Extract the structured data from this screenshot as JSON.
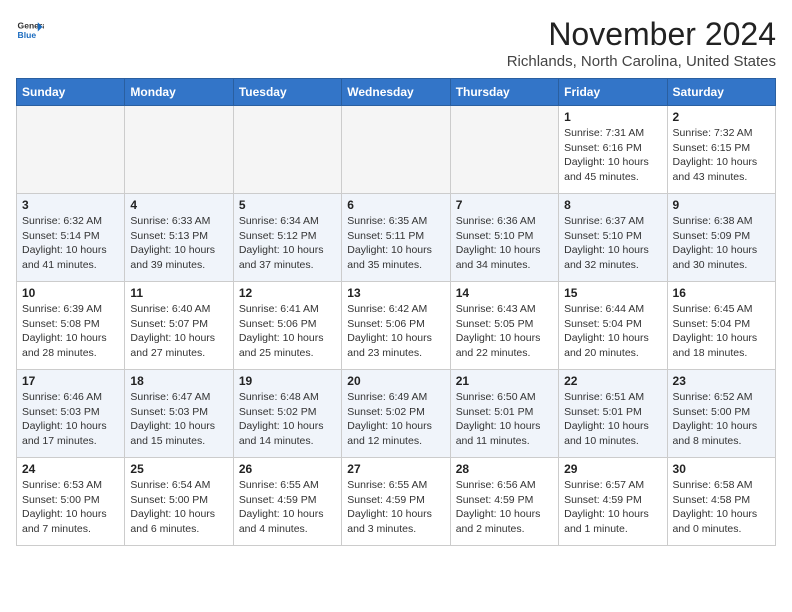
{
  "header": {
    "logo_line1": "General",
    "logo_line2": "Blue",
    "month": "November 2024",
    "location": "Richlands, North Carolina, United States"
  },
  "weekdays": [
    "Sunday",
    "Monday",
    "Tuesday",
    "Wednesday",
    "Thursday",
    "Friday",
    "Saturday"
  ],
  "weeks": [
    [
      {
        "day": "",
        "info": ""
      },
      {
        "day": "",
        "info": ""
      },
      {
        "day": "",
        "info": ""
      },
      {
        "day": "",
        "info": ""
      },
      {
        "day": "",
        "info": ""
      },
      {
        "day": "1",
        "info": "Sunrise: 7:31 AM\nSunset: 6:16 PM\nDaylight: 10 hours and 45 minutes."
      },
      {
        "day": "2",
        "info": "Sunrise: 7:32 AM\nSunset: 6:15 PM\nDaylight: 10 hours and 43 minutes."
      }
    ],
    [
      {
        "day": "3",
        "info": "Sunrise: 6:32 AM\nSunset: 5:14 PM\nDaylight: 10 hours and 41 minutes."
      },
      {
        "day": "4",
        "info": "Sunrise: 6:33 AM\nSunset: 5:13 PM\nDaylight: 10 hours and 39 minutes."
      },
      {
        "day": "5",
        "info": "Sunrise: 6:34 AM\nSunset: 5:12 PM\nDaylight: 10 hours and 37 minutes."
      },
      {
        "day": "6",
        "info": "Sunrise: 6:35 AM\nSunset: 5:11 PM\nDaylight: 10 hours and 35 minutes."
      },
      {
        "day": "7",
        "info": "Sunrise: 6:36 AM\nSunset: 5:10 PM\nDaylight: 10 hours and 34 minutes."
      },
      {
        "day": "8",
        "info": "Sunrise: 6:37 AM\nSunset: 5:10 PM\nDaylight: 10 hours and 32 minutes."
      },
      {
        "day": "9",
        "info": "Sunrise: 6:38 AM\nSunset: 5:09 PM\nDaylight: 10 hours and 30 minutes."
      }
    ],
    [
      {
        "day": "10",
        "info": "Sunrise: 6:39 AM\nSunset: 5:08 PM\nDaylight: 10 hours and 28 minutes."
      },
      {
        "day": "11",
        "info": "Sunrise: 6:40 AM\nSunset: 5:07 PM\nDaylight: 10 hours and 27 minutes."
      },
      {
        "day": "12",
        "info": "Sunrise: 6:41 AM\nSunset: 5:06 PM\nDaylight: 10 hours and 25 minutes."
      },
      {
        "day": "13",
        "info": "Sunrise: 6:42 AM\nSunset: 5:06 PM\nDaylight: 10 hours and 23 minutes."
      },
      {
        "day": "14",
        "info": "Sunrise: 6:43 AM\nSunset: 5:05 PM\nDaylight: 10 hours and 22 minutes."
      },
      {
        "day": "15",
        "info": "Sunrise: 6:44 AM\nSunset: 5:04 PM\nDaylight: 10 hours and 20 minutes."
      },
      {
        "day": "16",
        "info": "Sunrise: 6:45 AM\nSunset: 5:04 PM\nDaylight: 10 hours and 18 minutes."
      }
    ],
    [
      {
        "day": "17",
        "info": "Sunrise: 6:46 AM\nSunset: 5:03 PM\nDaylight: 10 hours and 17 minutes."
      },
      {
        "day": "18",
        "info": "Sunrise: 6:47 AM\nSunset: 5:03 PM\nDaylight: 10 hours and 15 minutes."
      },
      {
        "day": "19",
        "info": "Sunrise: 6:48 AM\nSunset: 5:02 PM\nDaylight: 10 hours and 14 minutes."
      },
      {
        "day": "20",
        "info": "Sunrise: 6:49 AM\nSunset: 5:02 PM\nDaylight: 10 hours and 12 minutes."
      },
      {
        "day": "21",
        "info": "Sunrise: 6:50 AM\nSunset: 5:01 PM\nDaylight: 10 hours and 11 minutes."
      },
      {
        "day": "22",
        "info": "Sunrise: 6:51 AM\nSunset: 5:01 PM\nDaylight: 10 hours and 10 minutes."
      },
      {
        "day": "23",
        "info": "Sunrise: 6:52 AM\nSunset: 5:00 PM\nDaylight: 10 hours and 8 minutes."
      }
    ],
    [
      {
        "day": "24",
        "info": "Sunrise: 6:53 AM\nSunset: 5:00 PM\nDaylight: 10 hours and 7 minutes."
      },
      {
        "day": "25",
        "info": "Sunrise: 6:54 AM\nSunset: 5:00 PM\nDaylight: 10 hours and 6 minutes."
      },
      {
        "day": "26",
        "info": "Sunrise: 6:55 AM\nSunset: 4:59 PM\nDaylight: 10 hours and 4 minutes."
      },
      {
        "day": "27",
        "info": "Sunrise: 6:55 AM\nSunset: 4:59 PM\nDaylight: 10 hours and 3 minutes."
      },
      {
        "day": "28",
        "info": "Sunrise: 6:56 AM\nSunset: 4:59 PM\nDaylight: 10 hours and 2 minutes."
      },
      {
        "day": "29",
        "info": "Sunrise: 6:57 AM\nSunset: 4:59 PM\nDaylight: 10 hours and 1 minute."
      },
      {
        "day": "30",
        "info": "Sunrise: 6:58 AM\nSunset: 4:58 PM\nDaylight: 10 hours and 0 minutes."
      }
    ]
  ]
}
